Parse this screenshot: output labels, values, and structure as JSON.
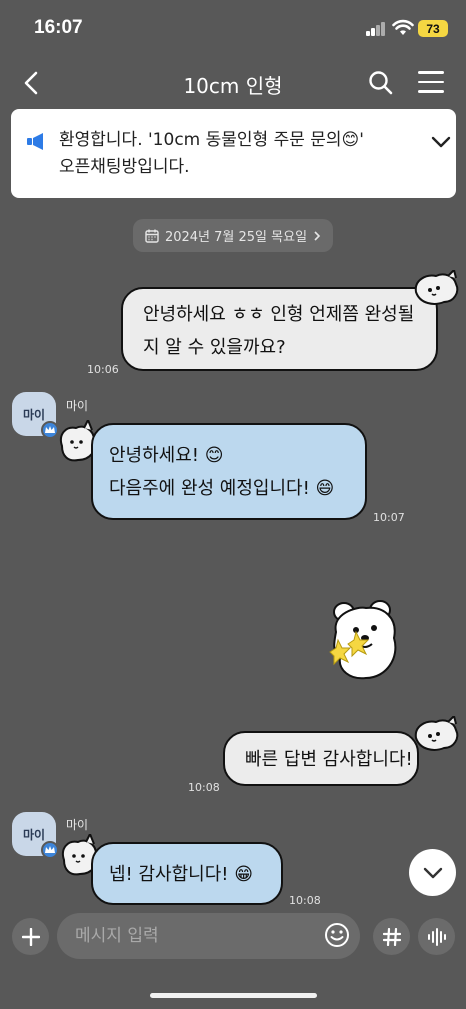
{
  "status": {
    "time": "16:07",
    "battery": "73"
  },
  "header": {
    "title": "10cm 인형"
  },
  "notice": {
    "text_line1": "환영합니다. '10cm 동물인형 주문 문의😊'",
    "text_line2": "오픈채팅방입니다."
  },
  "date_divider": {
    "label": "2024년 7월 25일 목요일"
  },
  "messages": [
    {
      "from": "me",
      "lines": [
        "안녕하세요 ㅎㅎ 인형 언제쯤 완성될",
        "지 알 수 있을까요?"
      ],
      "time": "10:06"
    },
    {
      "from": "마이",
      "avatar_label": "마이",
      "lines": [
        "안녕하세요! 😊",
        "다음주에 완성 예정입니다! 😄"
      ],
      "time": "10:07"
    },
    {
      "from": "me",
      "lines": [
        "빠른 답변 감사합니다!"
      ],
      "time": "10:08"
    },
    {
      "from": "마이",
      "avatar_label": "마이",
      "lines": [
        "넵! 감사합니다! 😁"
      ],
      "time": "10:08"
    }
  ],
  "composer": {
    "placeholder": "메시지 입력"
  },
  "icons": {
    "back": "chevron-left-icon",
    "search": "search-icon",
    "menu": "hamburger-menu-icon",
    "notice": "megaphone-icon",
    "expand": "chevron-down-icon",
    "calendar": "calendar-icon",
    "plus": "plus-icon",
    "emoji": "emoji-icon",
    "hash": "hash-icon",
    "voice": "voice-wave-icon"
  },
  "colors": {
    "background": "#585858",
    "my_bubble": "#ececec",
    "their_bubble": "#bcd8ee",
    "notice_accent": "#2d7be6",
    "battery": "#f5d742"
  }
}
